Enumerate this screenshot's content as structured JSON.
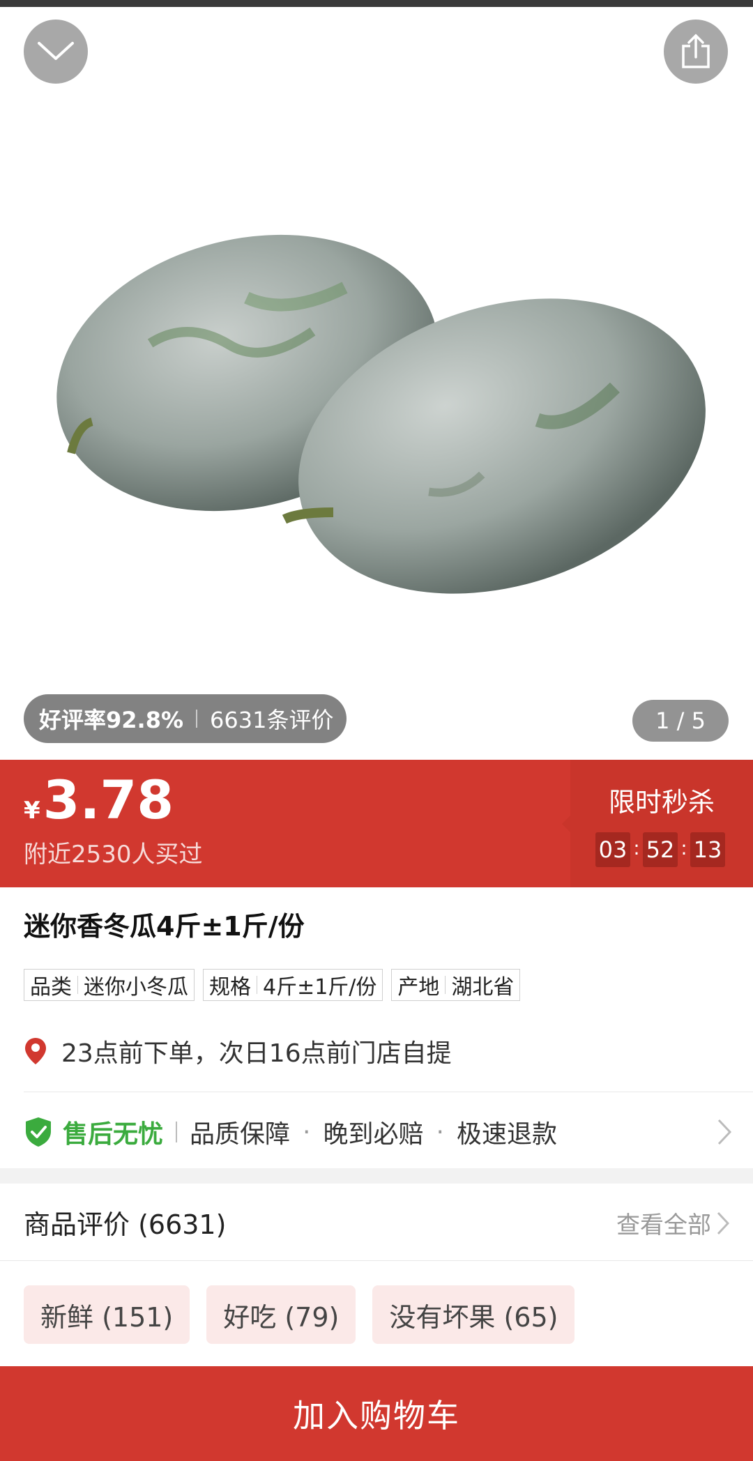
{
  "hero": {
    "image_description": "two winter melons",
    "rating_label": "好评率92.8%",
    "review_count_label": "6631条评价",
    "page_indicator": "1 / 5"
  },
  "price": {
    "currency": "¥",
    "value": "3.78",
    "buyers": "附近2530人买过"
  },
  "flash_sale": {
    "title": "限时秒杀",
    "hours": "03",
    "minutes": "52",
    "seconds": "13"
  },
  "product": {
    "title": "迷你香冬瓜4斤±1斤/份",
    "tags": [
      {
        "key": "品类",
        "value": "迷你小冬瓜"
      },
      {
        "key": "规格",
        "value": "4斤±1斤/份"
      },
      {
        "key": "产地",
        "value": "湖北省"
      }
    ],
    "pickup_note": "23点前下单，次日16点前门店自提"
  },
  "service": {
    "badge": "售后无忧",
    "items": [
      "品质保障",
      "晚到必赔",
      "极速退款"
    ]
  },
  "reviews": {
    "header": "商品评价 (6631)",
    "view_all": "查看全部",
    "chips": [
      "新鲜 (151)",
      "好吃 (79)",
      "没有坏果 (65)"
    ]
  },
  "cart_button": "加入购物车",
  "colors": {
    "accent_red": "#d1382f",
    "service_green": "#3bab3e"
  }
}
